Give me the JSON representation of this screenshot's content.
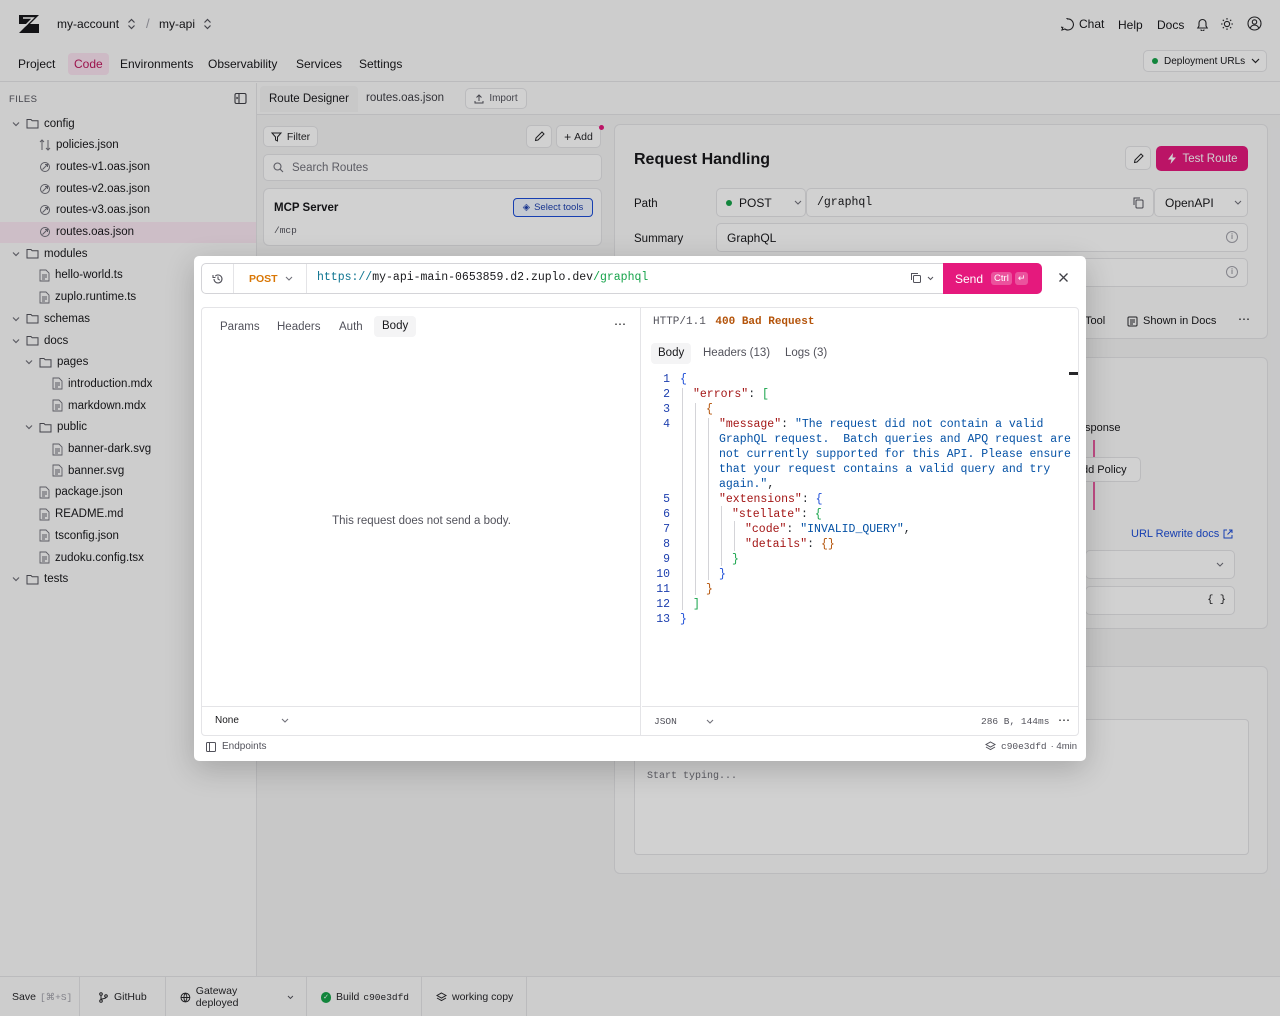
{
  "header": {
    "account": "my-account",
    "project": "my-api",
    "separator": "/",
    "chat": "Chat",
    "help": "Help",
    "docs": "Docs"
  },
  "nav": {
    "tabs": [
      "Project",
      "Code",
      "Environments",
      "Observability",
      "Services",
      "Settings"
    ],
    "active": "Code",
    "deployment_urls": "Deployment URLs"
  },
  "sidebar": {
    "title": "FILES",
    "tree": [
      {
        "label": "config",
        "type": "folder",
        "depth": 0,
        "open": true
      },
      {
        "label": "policies.json",
        "type": "policy",
        "depth": 1
      },
      {
        "label": "routes-v1.oas.json",
        "type": "route",
        "depth": 1
      },
      {
        "label": "routes-v2.oas.json",
        "type": "route",
        "depth": 1
      },
      {
        "label": "routes-v3.oas.json",
        "type": "route",
        "depth": 1
      },
      {
        "label": "routes.oas.json",
        "type": "route",
        "depth": 1,
        "selected": true
      },
      {
        "label": "modules",
        "type": "folder",
        "depth": 0,
        "open": true
      },
      {
        "label": "hello-world.ts",
        "type": "file",
        "depth": 1
      },
      {
        "label": "zuplo.runtime.ts",
        "type": "file",
        "depth": 1
      },
      {
        "label": "schemas",
        "type": "folder",
        "depth": 0,
        "open": true
      },
      {
        "label": "docs",
        "type": "folder",
        "depth": 0,
        "open": true
      },
      {
        "label": "pages",
        "type": "folder",
        "depth": 1,
        "open": true
      },
      {
        "label": "introduction.mdx",
        "type": "file",
        "depth": 2
      },
      {
        "label": "markdown.mdx",
        "type": "file",
        "depth": 2
      },
      {
        "label": "public",
        "type": "folder",
        "depth": 1,
        "open": true
      },
      {
        "label": "banner-dark.svg",
        "type": "file",
        "depth": 2
      },
      {
        "label": "banner.svg",
        "type": "file",
        "depth": 2
      },
      {
        "label": "package.json",
        "type": "file",
        "depth": 1
      },
      {
        "label": "README.md",
        "type": "file",
        "depth": 1
      },
      {
        "label": "tsconfig.json",
        "type": "file",
        "depth": 1
      },
      {
        "label": "zudoku.config.tsx",
        "type": "file",
        "depth": 1
      },
      {
        "label": "tests",
        "type": "folder",
        "depth": 0,
        "open": true
      }
    ]
  },
  "editor": {
    "tabs": [
      "Route Designer",
      "routes.oas.json"
    ],
    "import": "Import",
    "filter": "Filter",
    "add": "Add",
    "search_placeholder": "Search Routes",
    "mcp_title": "MCP Server",
    "mcp_path": "/mcp",
    "select_tools": "Select tools"
  },
  "request_handling": {
    "title": "Request Handling",
    "test_route": "Test Route",
    "path_label": "Path",
    "method": "POST",
    "path": "/graphql",
    "openapi": "OpenAPI",
    "summary_label": "Summary",
    "summary": "GraphQL",
    "tool": "Tool",
    "shown_in_docs": "Shown in Docs",
    "response_fragment": "sponse",
    "add_policy_fragment": "dd Policy",
    "url_rewrite_docs": "URL Rewrite docs",
    "braces": "{ }",
    "start_typing": "Start typing..."
  },
  "modal": {
    "method": "POST",
    "url_scheme": "https://",
    "url_host": "my-api-main-0653859.d2.zuplo.dev",
    "url_path": "/graphql",
    "send": "Send",
    "send_kbd": "Ctrl",
    "send_enter": "↵",
    "request_tabs": [
      "Params",
      "Headers",
      "Auth",
      "Body"
    ],
    "request_active": "Body",
    "empty_body": "This request does not send a body.",
    "body_type": "None",
    "status_proto": "HTTP/1.1",
    "status_code": "400 Bad Request",
    "response_tabs": [
      "Body",
      "Headers (13)",
      "Logs (3)"
    ],
    "response_active": "Body",
    "response_format": "JSON",
    "response_meta": "286 B, 144ms",
    "endpoints": "Endpoints",
    "commit": "c90e3dfd",
    "age": "· 4min",
    "code_numbers": [
      "1",
      "2",
      "3",
      "4",
      "",
      "",
      "",
      "",
      "5",
      "6",
      "7",
      "8",
      "9",
      "10",
      "11",
      "12",
      "13"
    ]
  },
  "footer": {
    "save": "Save",
    "save_kbd": "[⌘+S]",
    "github": "GitHub",
    "gateway": "Gateway deployed",
    "build": "Build",
    "build_hash": "c90e3dfd",
    "working_copy": "working copy"
  },
  "colors": {
    "accent": "#e5197d",
    "status_green": "#16a34a",
    "method_orange": "#d97706"
  }
}
